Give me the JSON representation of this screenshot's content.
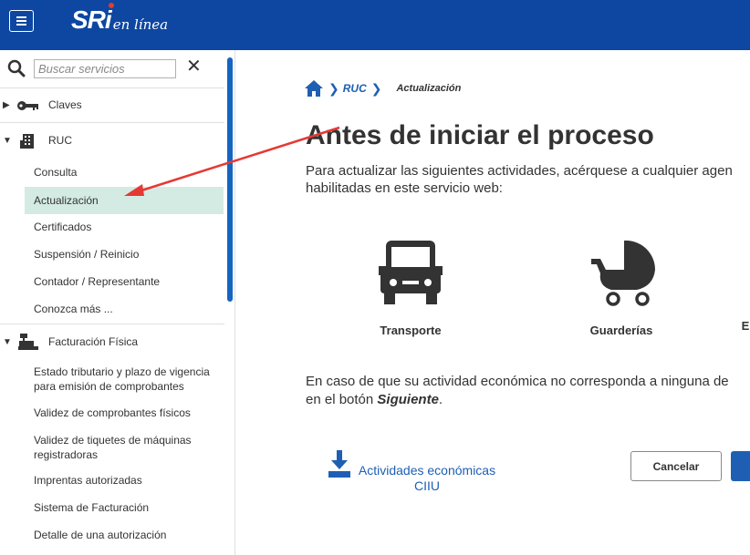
{
  "header": {
    "logo_main": "SRi",
    "logo_sub": "en línea"
  },
  "search": {
    "placeholder": "Buscar servicios"
  },
  "sidebar": {
    "groups": [
      {
        "label": "Claves",
        "icon": "key-icon",
        "expanded": false
      },
      {
        "label": "RUC",
        "icon": "building-icon",
        "expanded": true,
        "items": [
          "Consulta",
          "Actualización",
          "Certificados",
          "Suspensión / Reinicio",
          "Contador / Representante",
          "Conozca más ..."
        ]
      },
      {
        "label": "Facturación Física",
        "icon": "cash-register-icon",
        "expanded": true,
        "items": [
          "Estado tributario y plazo de vigencia para emisión de comprobantes",
          "Validez de comprobantes físicos",
          "Validez de tiquetes de máquinas registradoras",
          "Imprentas autorizadas",
          "Sistema de Facturación",
          "Detalle de una autorización"
        ]
      }
    ],
    "active_item": "Actualización"
  },
  "breadcrumb": {
    "home_icon": "home-icon",
    "link": "RUC",
    "current": "Actualización"
  },
  "main": {
    "title": "Antes de iniciar el proceso",
    "intro_line1": "Para actualizar las siguientes actividades, acérquese a cualquier agen",
    "intro_line2": "habilitadas en este servicio web:",
    "activities": [
      {
        "label": "Transporte",
        "icon": "truck-icon"
      },
      {
        "label": "Guarderías",
        "icon": "stroller-icon"
      },
      {
        "label": "E",
        "icon": ""
      }
    ],
    "note_line1": "En caso de que su actividad económica no corresponda a ninguna de",
    "note_line2_prefix": "en el botón ",
    "note_line2_bold": "Siguiente",
    "note_line2_suffix": ".",
    "download_label_line1": "Actividades económicas",
    "download_label_line2": "CIIU",
    "cancel_label": "Cancelar"
  },
  "colors": {
    "header_bg": "#0d47a1",
    "accent": "#1e5fb4",
    "active_bg": "#d4ebe3",
    "annotation_arrow": "#e53935"
  }
}
